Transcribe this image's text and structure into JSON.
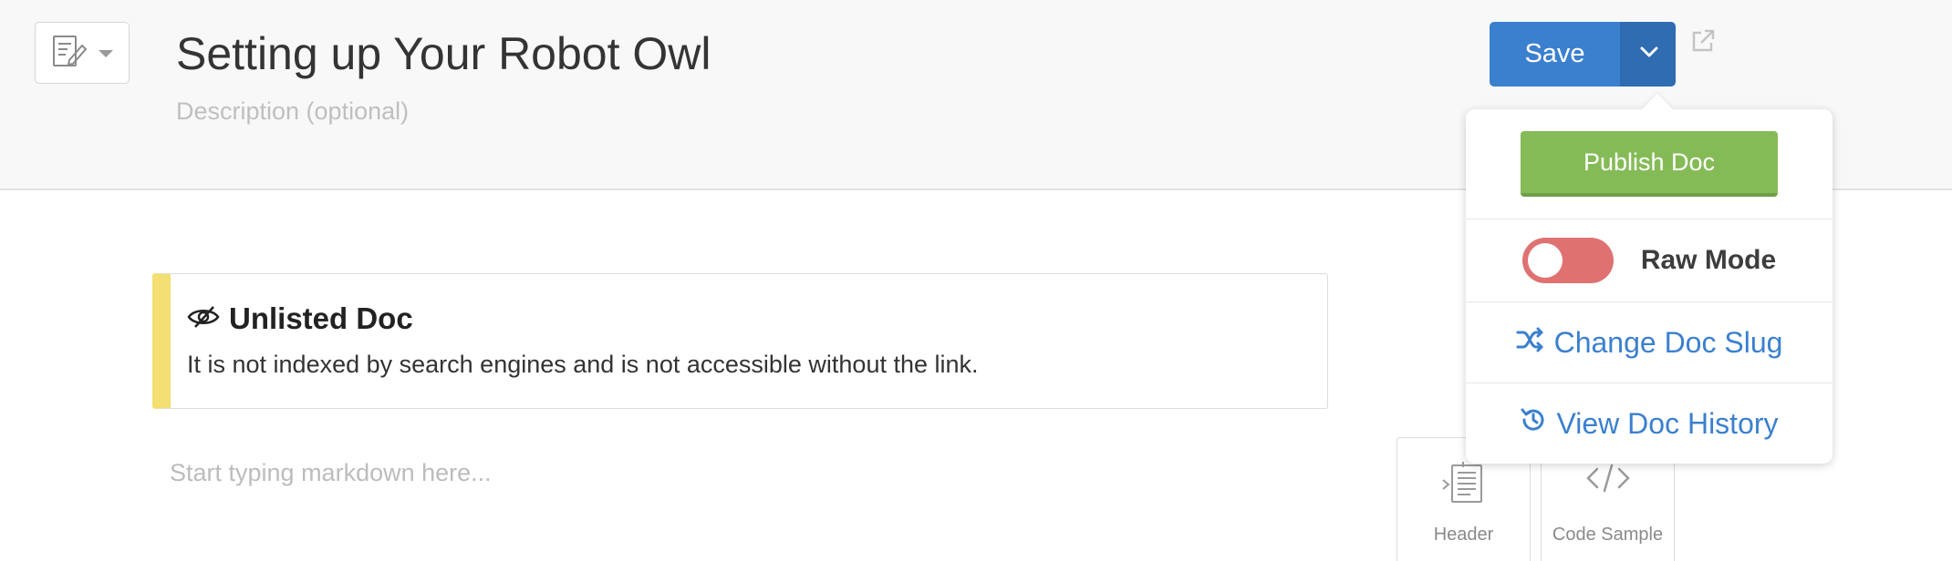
{
  "doc": {
    "title": "Setting up Your Robot Owl",
    "description_placeholder": "Description (optional)"
  },
  "toolbar": {
    "save_label": "Save"
  },
  "dropdown": {
    "publish_label": "Publish Doc",
    "raw_mode_label": "Raw Mode",
    "raw_mode_enabled": false,
    "change_slug_label": "Change Doc Slug",
    "view_history_label": "View Doc History"
  },
  "notice": {
    "title": "Unlisted Doc",
    "text": "It is not indexed by search engines and is not accessible without the link."
  },
  "editor": {
    "placeholder": "Start typing markdown here..."
  },
  "tools": [
    {
      "label": "Header",
      "icon": "header-icon"
    },
    {
      "label": "Code Sample",
      "icon": "code-icon"
    }
  ],
  "colors": {
    "primary": "#3b80ce",
    "success": "#85bb57",
    "danger_toggle": "#e07171",
    "notice_accent": "#f3df72"
  }
}
